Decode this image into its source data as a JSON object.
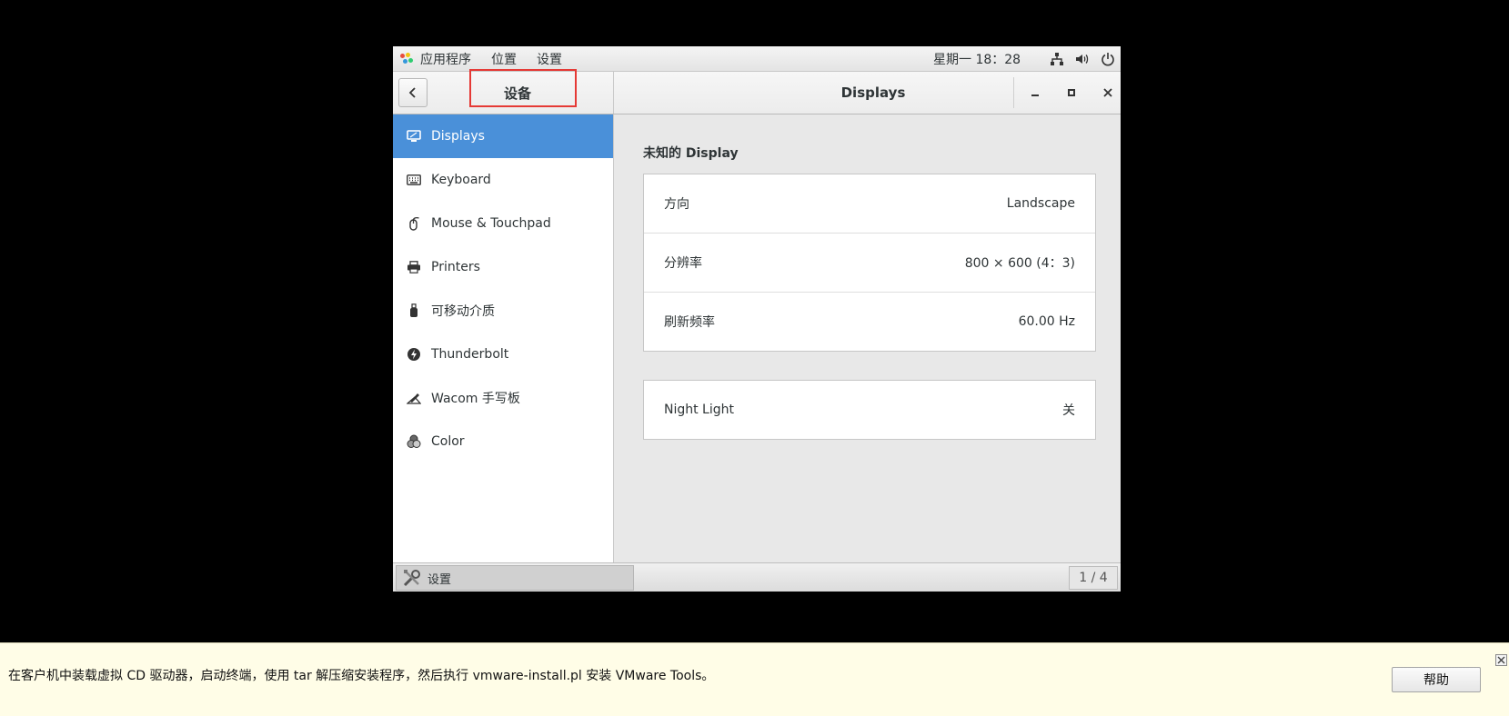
{
  "topbar": {
    "menus": [
      "应用程序",
      "位置",
      "设置"
    ],
    "clock": "星期一 18：28",
    "tray_icons": [
      "network-icon",
      "volume-icon",
      "power-icon"
    ]
  },
  "headerbar": {
    "panel_title": "设备",
    "title": "Displays"
  },
  "sidebar": {
    "items": [
      {
        "label": "Displays",
        "icon": "display-icon"
      },
      {
        "label": "Keyboard",
        "icon": "keyboard-icon"
      },
      {
        "label": "Mouse & Touchpad",
        "icon": "mouse-icon"
      },
      {
        "label": "Printers",
        "icon": "printer-icon"
      },
      {
        "label": "可移动介质",
        "icon": "usb-drive-icon"
      },
      {
        "label": "Thunderbolt",
        "icon": "thunderbolt-icon"
      },
      {
        "label": "Wacom 手写板",
        "icon": "tablet-icon"
      },
      {
        "label": "Color",
        "icon": "color-icon"
      }
    ],
    "selected_index": 0
  },
  "display": {
    "section_title": "未知的 Display",
    "rows": [
      {
        "label": "方向",
        "value": "Landscape"
      },
      {
        "label": "分辨率",
        "value": "800 × 600 (4：3)"
      },
      {
        "label": "刷新频率",
        "value": "60.00 Hz"
      }
    ],
    "night_light": {
      "label": "Night Light",
      "value": "关"
    }
  },
  "taskbar": {
    "task_label": "设置",
    "pager": "1 / 4"
  },
  "notification": {
    "text": "在客户机中装载虚拟 CD 驱动器，启动终端，使用 tar 解压缩安装程序，然后执行 vmware-install.pl 安装 VMware Tools。",
    "help_label": "帮助"
  },
  "colors": {
    "accent": "#4a90d9",
    "highlight_box": "#e53935",
    "notification_bg": "#fffde7"
  }
}
